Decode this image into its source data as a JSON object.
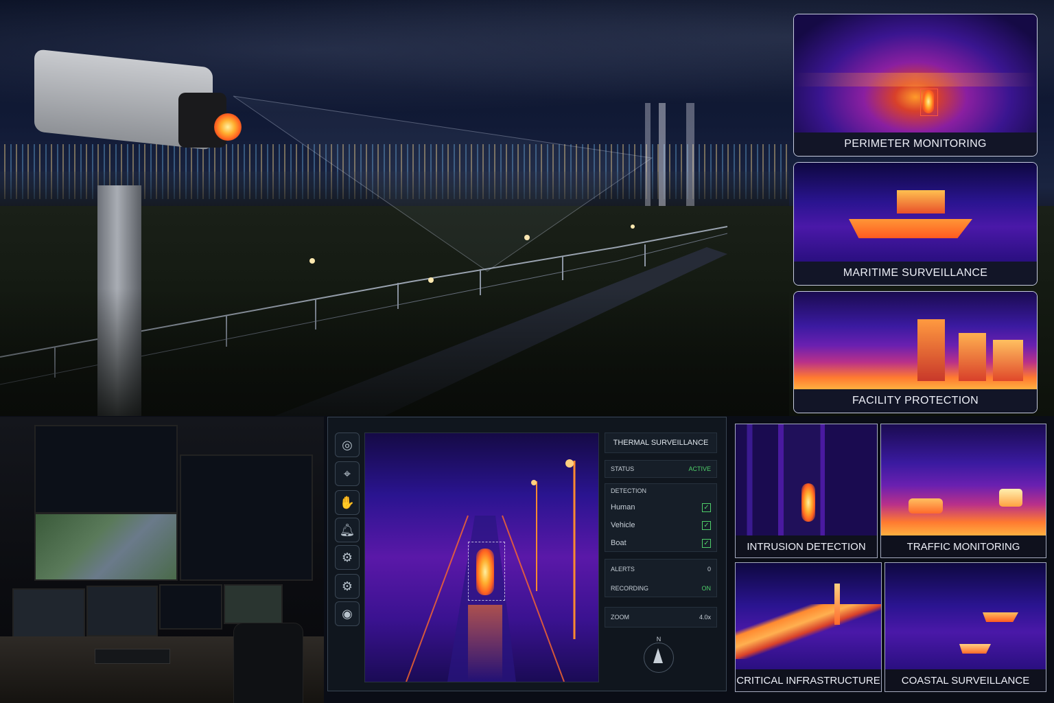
{
  "top_tiles": [
    {
      "label": "PERIMETER MONITORING"
    },
    {
      "label": "MARITIME SURVEILLANCE"
    },
    {
      "label": "FACILITY PROTECTION"
    }
  ],
  "panel": {
    "title": "THERMAL SURVEILLANCE",
    "status_label": "STATUS",
    "status_value": "ACTIVE",
    "detection_label": "DETECTION",
    "detections": [
      {
        "label": "Human",
        "checked": true
      },
      {
        "label": "Vehicle",
        "checked": true
      },
      {
        "label": "Boat",
        "checked": true
      }
    ],
    "alerts_label": "ALERTS",
    "alerts_value": "0",
    "recording_label": "RECORDING",
    "recording_value": "ON",
    "zoom_label": "ZOOM",
    "zoom_value": "4.0x",
    "compass_label": "N",
    "tools": [
      "camera-icon",
      "crosshair-icon",
      "pan-icon",
      "bell-icon",
      "settings-icon",
      "gear-icon",
      "target-icon"
    ]
  },
  "bottom_tiles": [
    {
      "label": "INTRUSION DETECTION"
    },
    {
      "label": "TRAFFIC MONITORING"
    },
    {
      "label": "CRITICAL INFRASTRUCTURE"
    },
    {
      "label": "COASTAL SURVEILLANCE"
    }
  ],
  "colors": {
    "accent_green": "#4fd06a",
    "panel_bg": "#10161e",
    "thermal_hot": "#ff8a2a",
    "thermal_cold": "#2a1490"
  }
}
